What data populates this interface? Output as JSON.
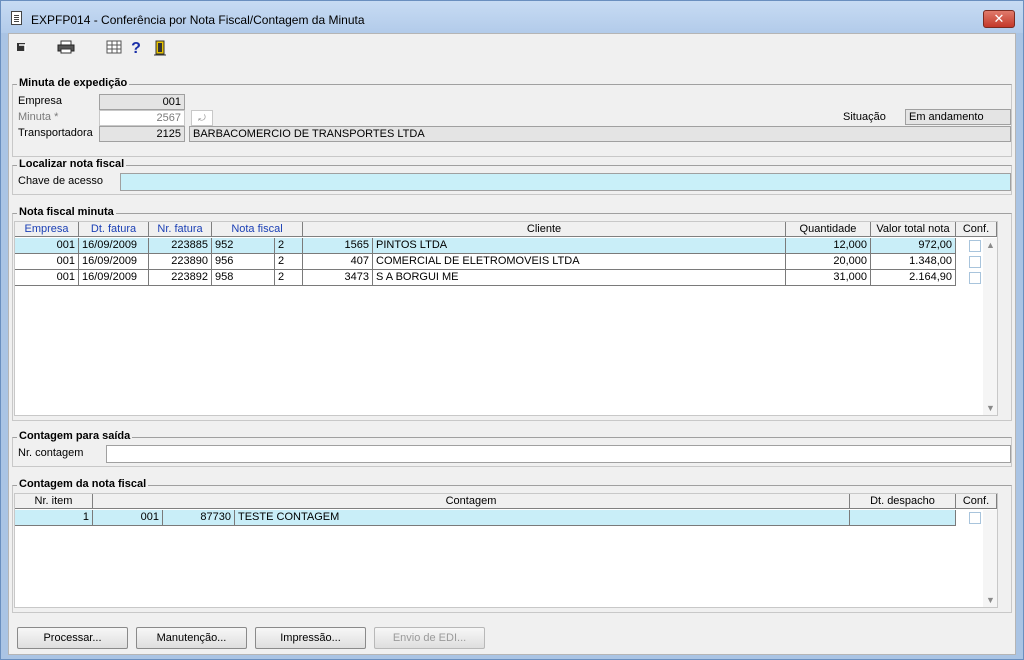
{
  "window": {
    "title": "EXPFP014 - Conferência por Nota Fiscal/Contagem da Minuta",
    "close_label": "✕"
  },
  "toolbar": {
    "icons": [
      "exit-arrow-icon",
      "printer-icon",
      "calculator-icon",
      "help-icon",
      "door-exit-icon"
    ]
  },
  "minuta_section": {
    "title": "Minuta de expedição",
    "empresa_label": "Empresa",
    "empresa_value": "001",
    "minuta_label": "Minuta *",
    "minuta_value": "2567",
    "transportadora_label": "Transportadora",
    "transportadora_code": "2125",
    "transportadora_name": "BARBACOMERCIO DE TRANSPORTES LTDA",
    "situacao_label": "Situação",
    "situacao_value": "Em andamento"
  },
  "localizar_section": {
    "title": "Localizar nota fiscal",
    "chave_label": "Chave de acesso",
    "chave_value": ""
  },
  "nota_section": {
    "title": "Nota fiscal minuta",
    "headers": [
      "Empresa",
      "Dt. fatura",
      "Nr. fatura",
      "Nota fiscal",
      "Cliente",
      "Quantidade",
      "Valor total nota",
      "Conf."
    ],
    "rows": [
      {
        "empresa": "001",
        "dt_fatura": "16/09/2009",
        "nr_fatura": "223885",
        "nf": "952",
        "serie": "2",
        "cli_code": "1565",
        "cliente": "PINTOS LTDA",
        "qtd": "12,000",
        "valor": "972,00",
        "selected": true
      },
      {
        "empresa": "001",
        "dt_fatura": "16/09/2009",
        "nr_fatura": "223890",
        "nf": "956",
        "serie": "2",
        "cli_code": "407",
        "cliente": "COMERCIAL DE ELETROMOVEIS LTDA",
        "qtd": "20,000",
        "valor": "1.348,00",
        "selected": false
      },
      {
        "empresa": "001",
        "dt_fatura": "16/09/2009",
        "nr_fatura": "223892",
        "nf": "958",
        "serie": "2",
        "cli_code": "3473",
        "cliente": "S A BORGUI ME",
        "qtd": "31,000",
        "valor": "2.164,90",
        "selected": false
      }
    ]
  },
  "contagem_saida": {
    "title": "Contagem para saída",
    "label": "Nr. contagem",
    "value": ""
  },
  "contagem_nota": {
    "title": "Contagem da nota fiscal",
    "headers": [
      "Nr. item",
      "Contagem",
      "Dt. despacho",
      "Conf."
    ],
    "rows": [
      {
        "item": "1",
        "empresa": "001",
        "numero": "87730",
        "descricao": "TESTE CONTAGEM",
        "dt": ""
      }
    ]
  },
  "buttons": {
    "processar": "Processar...",
    "manutencao": "Manutenção...",
    "impressao": "Impressão...",
    "envio": "Envio de EDI..."
  }
}
